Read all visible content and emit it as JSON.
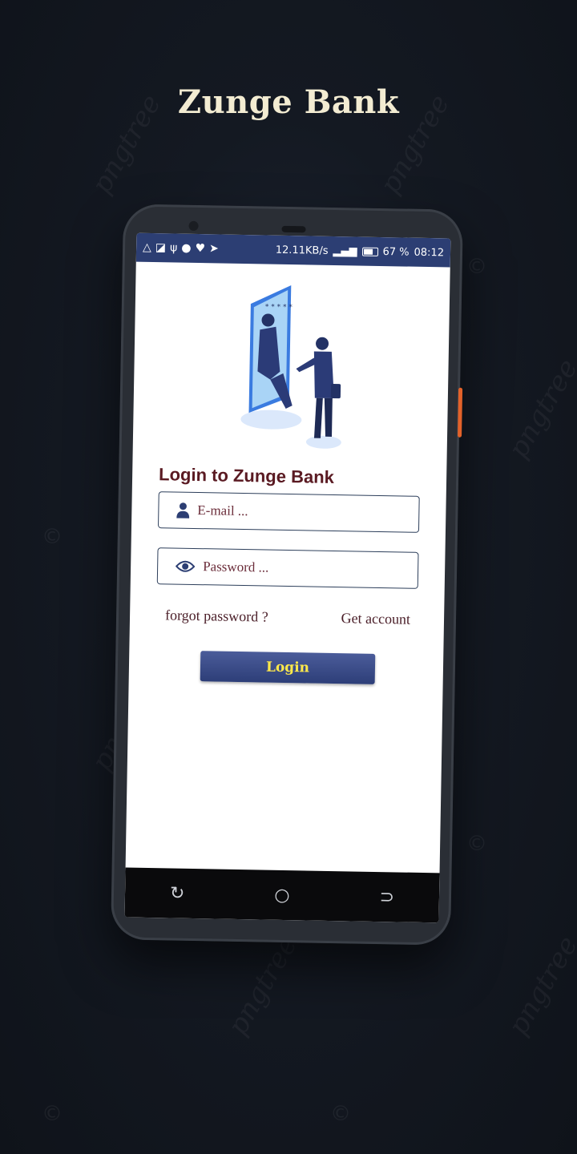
{
  "brand_title": "Zunge Bank",
  "watermark_text": "pngtree",
  "status_bar": {
    "network_speed": "12.11KB/s",
    "battery": "67 %",
    "time": "08:12"
  },
  "login": {
    "heading": "Login to Zunge Bank",
    "email_placeholder": "E-mail ...",
    "password_placeholder": "Password ...",
    "forgot_password": "forgot password ?",
    "get_account": "Get account",
    "login_button": "Login"
  },
  "nav_icons": [
    "recent-apps-icon",
    "home-icon",
    "back-icon"
  ],
  "colors": {
    "status_bar": "#2c3e73",
    "button": "#3b4c8a",
    "button_text": "#ffe94a",
    "heading": "#5a1a22"
  }
}
